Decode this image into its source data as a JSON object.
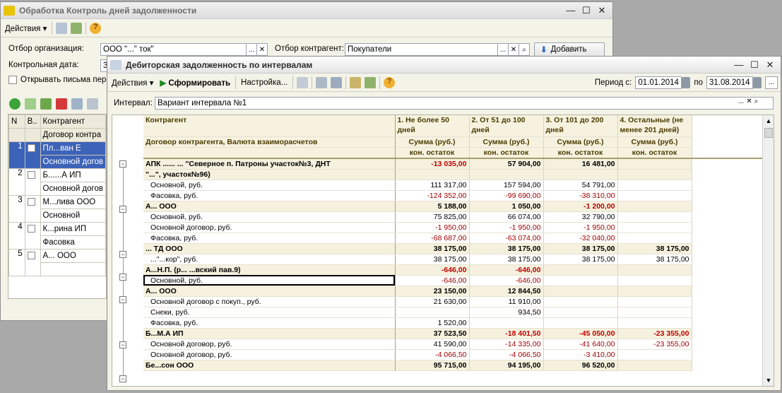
{
  "back_window": {
    "title": "Обработка  Контроль дней задолженности",
    "actions_label": "Действия",
    "org_label": "Отбор организация:",
    "org_value": "ООО \"...\" ток\"",
    "contractor_label": "Отбор контрагент:",
    "contractor_value": "Покупатели",
    "add_button": "Добавить",
    "control_date_label": "Контрольная дата:",
    "control_date_value": "3",
    "open_letters_label": "Открывать письма пере",
    "columns": [
      "N",
      "В..",
      "Контрагент"
    ],
    "subheader": "Договор контра",
    "rows": [
      {
        "n": "1",
        "name": "Пл...ван Е",
        "contract": "Основной догов"
      },
      {
        "n": "2",
        "name": "Б......А ИП",
        "contract": "Основной догов"
      },
      {
        "n": "3",
        "name": "М...лива ООО",
        "contract": "Основной"
      },
      {
        "n": "4",
        "name": "К...рина ИП",
        "contract": "Фасовка"
      },
      {
        "n": "5",
        "name": "А... ООО",
        "contract": ""
      }
    ]
  },
  "report_window": {
    "title": "Дебиторская задолженность по интервалам",
    "actions_label": "Действия",
    "generate_label": "Сформировать",
    "settings_label": "Настройка...",
    "period_label": "Период с:",
    "period_from": "01.01.2014",
    "period_to_label": "по",
    "period_to": "31.08.2014",
    "interval_label": "Интервал:",
    "interval_value": "Вариант интервала №1",
    "head": {
      "c1": "Контрагент",
      "c1b": "Договор контрагента, Валюта взаиморасчетов",
      "cols": [
        "1. Не более 50 дней",
        "2. От 51 до 100 дней",
        "3. От 101 до 200 дней",
        "4. Остальные (не менее 201 дней)"
      ],
      "sum_label": "Сумма (руб.)",
      "rest_label": "кон. остаток"
    },
    "rows": [
      {
        "t": "gr",
        "name": "АПК ...... ... \"Северное п. Патроны участок№3, ДНТ",
        "v": [
          "-13 035,00",
          "57 904,00",
          "16 481,00",
          ""
        ]
      },
      {
        "t": "gr",
        "name": "\"...\", участок№96)",
        "v": [
          "",
          "",
          "",
          ""
        ]
      },
      {
        "t": "sub",
        "name": "Основной, руб.",
        "v": [
          "111 317,00",
          "157 594,00",
          "54 791,00",
          ""
        ]
      },
      {
        "t": "sub",
        "name": "Фасовка, руб.",
        "v": [
          "-124 352,00",
          "-99 690,00",
          "-38 310,00",
          ""
        ]
      },
      {
        "t": "gr",
        "name": "А... ООО",
        "v": [
          "5 188,00",
          "1 050,00",
          "-1 200,00",
          ""
        ]
      },
      {
        "t": "sub",
        "name": "Основной, руб.",
        "v": [
          "75 825,00",
          "66 074,00",
          "32 790,00",
          ""
        ]
      },
      {
        "t": "sub",
        "name": "Основной договор, руб.",
        "v": [
          "-1 950,00",
          "-1 950,00",
          "-1 950,00",
          ""
        ]
      },
      {
        "t": "sub",
        "name": "Фасовка, руб.",
        "v": [
          "-68 687,00",
          "-63 074,00",
          "-32 040,00",
          ""
        ]
      },
      {
        "t": "gr",
        "name": "... ТД ООО",
        "v": [
          "38 175,00",
          "38 175,00",
          "38 175,00",
          "38 175,00"
        ]
      },
      {
        "t": "sub",
        "name": "...\"...кор\", руб.",
        "v": [
          "38 175,00",
          "38 175,00",
          "38 175,00",
          "38 175,00"
        ]
      },
      {
        "t": "gr",
        "name": "А...Н.П. (р... ...вский пав.9)",
        "v": [
          "-646,00",
          "-646,00",
          "",
          ""
        ]
      },
      {
        "t": "sel",
        "name": "Основной, руб.",
        "v": [
          "-646,00",
          "-646,00",
          "",
          ""
        ]
      },
      {
        "t": "gr",
        "name": "А... ООО",
        "v": [
          "23 150,00",
          "12 844,50",
          "",
          ""
        ]
      },
      {
        "t": "sub",
        "name": "Основной договор с покуп., руб.",
        "v": [
          "21 630,00",
          "11 910,00",
          "",
          ""
        ]
      },
      {
        "t": "sub",
        "name": "Снеки, руб.",
        "v": [
          "",
          "934,50",
          "",
          ""
        ]
      },
      {
        "t": "sub",
        "name": "Фасовка, руб.",
        "v": [
          "1 520,00",
          "",
          "",
          ""
        ]
      },
      {
        "t": "gr",
        "name": "Б...М.А ИП",
        "v": [
          "37 523,50",
          "-18 401,50",
          "-45 050,00",
          "-23 355,00"
        ]
      },
      {
        "t": "sub",
        "name": "Основной договор, руб.",
        "v": [
          "41 590,00",
          "-14 335,00",
          "-41 640,00",
          "-23 355,00"
        ]
      },
      {
        "t": "sub",
        "name": "Основной договор, руб.",
        "v": [
          "-4 066,50",
          "-4 066,50",
          "-3 410,00",
          ""
        ]
      },
      {
        "t": "gr",
        "name": "Бе...сон ООО",
        "v": [
          "95 715,00",
          "94 195,00",
          "96 520,00",
          ""
        ]
      }
    ]
  }
}
